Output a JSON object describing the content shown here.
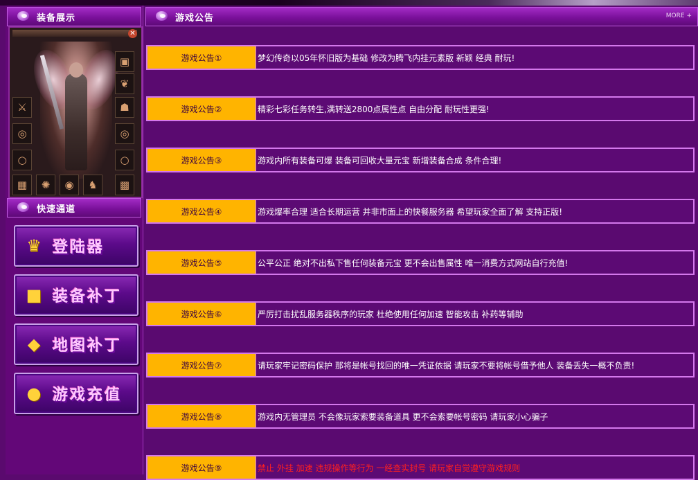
{
  "left_panel": {
    "equip_title": "装备展示",
    "quick_title": "快速通道",
    "quick_buttons": [
      {
        "label": "登陆器",
        "icon": "login-icon"
      },
      {
        "label": "装备补丁",
        "icon": "equipment-patch-icon"
      },
      {
        "label": "地图补丁",
        "icon": "map-patch-icon"
      },
      {
        "label": "游戏充值",
        "icon": "coins-icon"
      }
    ]
  },
  "main": {
    "title": "游戏公告",
    "more_label": "MORE +",
    "notices": [
      {
        "tag": "游戏公告①",
        "text": "梦幻传奇以05年怀旧版为基础 修改为腾飞内挂元素版 新颖 经典 耐玩!"
      },
      {
        "tag": "游戏公告②",
        "text": "精彩七彩任务转生,满转送2800点属性点 自由分配 耐玩性更强!"
      },
      {
        "tag": "游戏公告③",
        "text": "游戏内所有装备可爆 装备可回收大量元宝 新增装备合成 条件合理!"
      },
      {
        "tag": "游戏公告④",
        "text": "游戏爆率合理 适合长期运营 并非市面上的快餐服务器 希望玩家全面了解 支持正版!"
      },
      {
        "tag": "游戏公告⑤",
        "text": "公平公正 绝对不出私下售任何装备元宝 更不会出售属性 唯一消费方式网站自行充值!"
      },
      {
        "tag": "游戏公告⑥",
        "text": "严厉打击扰乱服务器秩序的玩家 杜绝使用任何加速 智能攻击 补药等辅助"
      },
      {
        "tag": "游戏公告⑦",
        "text": "请玩家牢记密码保护 那将是帐号找回的唯一凭证依据 请玩家不要将帐号借予他人 装备丢失一概不负责!"
      },
      {
        "tag": "游戏公告⑧",
        "text": "游戏内无管理员 不会像玩家索要装备道具 更不会索要帐号密码 请玩家小心骗子"
      },
      {
        "tag": "游戏公告⑨",
        "text": "禁止 外挂 加速 违规操作等行为 一经查实封号 请玩家自觉遵守游戏规则",
        "color": "#ff2020"
      }
    ]
  },
  "colors": {
    "accent": "#ffb400",
    "background": "#5a0a6e",
    "border": "#d478ec"
  }
}
